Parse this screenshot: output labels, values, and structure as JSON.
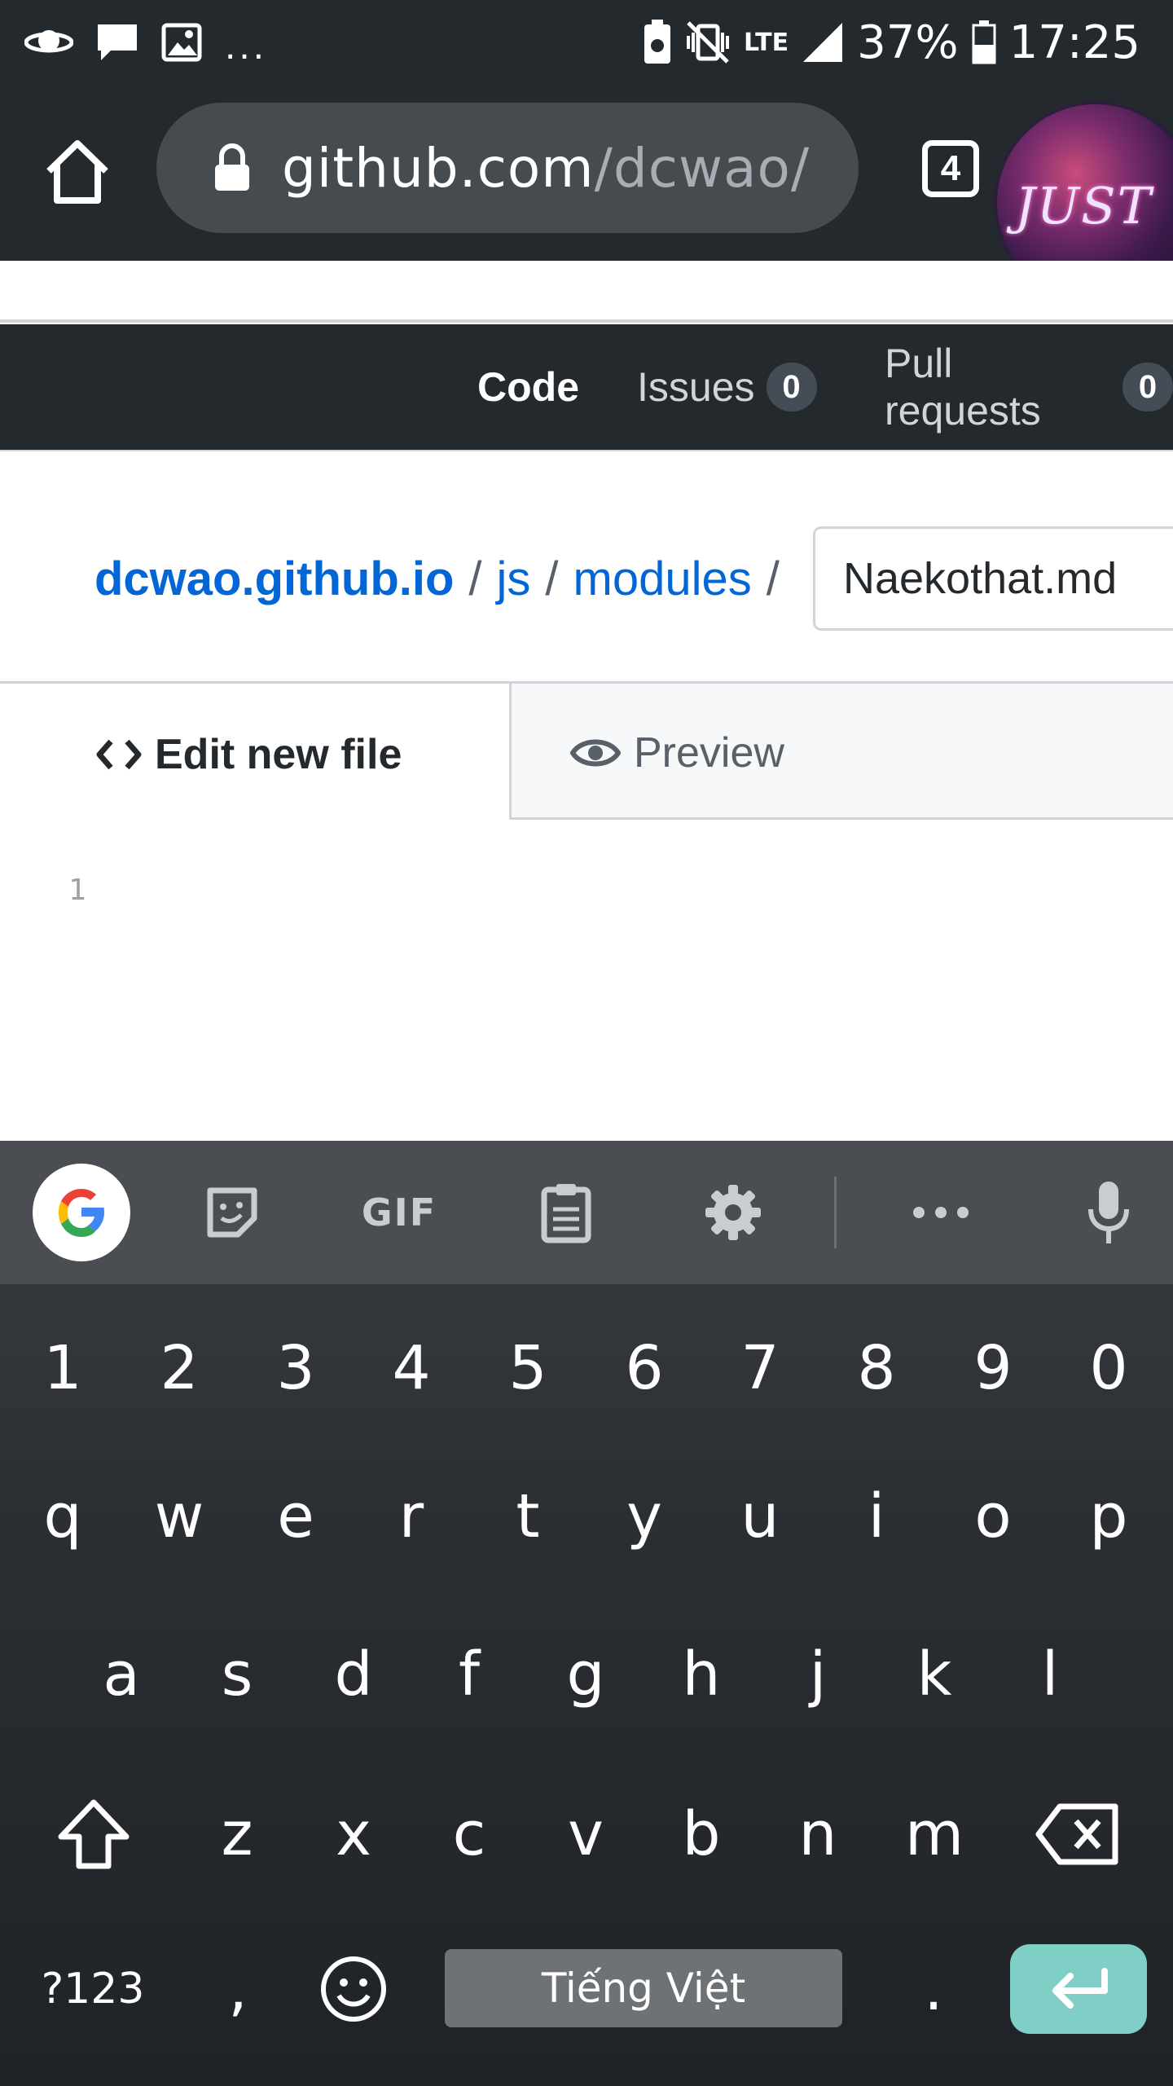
{
  "status_bar": {
    "signal_label": "LTE",
    "battery": "37%",
    "time": "17:25",
    "more_indicator": "..."
  },
  "browser": {
    "url_host": "github.com",
    "url_path": "/dcwao/",
    "tab_count": "4",
    "avatar_text": "JUST"
  },
  "repo_nav": {
    "code_label": "Code",
    "issues_label": "Issues",
    "issues_count": "0",
    "pulls_label": "Pull requests",
    "pulls_count": "0"
  },
  "breadcrumb": {
    "repo": "dcwao.github.io",
    "sep": "/",
    "dir1": "js",
    "dir2": "modules",
    "filename_value": "Naekothat.md"
  },
  "editor": {
    "tab_edit_label": "Edit new file",
    "tab_preview_label": "Preview",
    "line_number": "1"
  },
  "keyboard": {
    "toolbar": {
      "gif_label": "GIF"
    },
    "number_row": [
      "1",
      "2",
      "3",
      "4",
      "5",
      "6",
      "7",
      "8",
      "9",
      "0"
    ],
    "row1": [
      "q",
      "w",
      "e",
      "r",
      "t",
      "y",
      "u",
      "i",
      "o",
      "p"
    ],
    "row2": [
      "a",
      "s",
      "d",
      "f",
      "g",
      "h",
      "j",
      "k",
      "l"
    ],
    "row3": [
      "z",
      "x",
      "c",
      "v",
      "b",
      "n",
      "m"
    ],
    "symbols_key": "?123",
    "comma_key": ",",
    "period_key": ".",
    "space_label": "Tiếng Việt"
  },
  "colors": {
    "header_bg": "#24292e",
    "link_blue": "#0366d6",
    "enter_key": "#7fcfc6"
  }
}
